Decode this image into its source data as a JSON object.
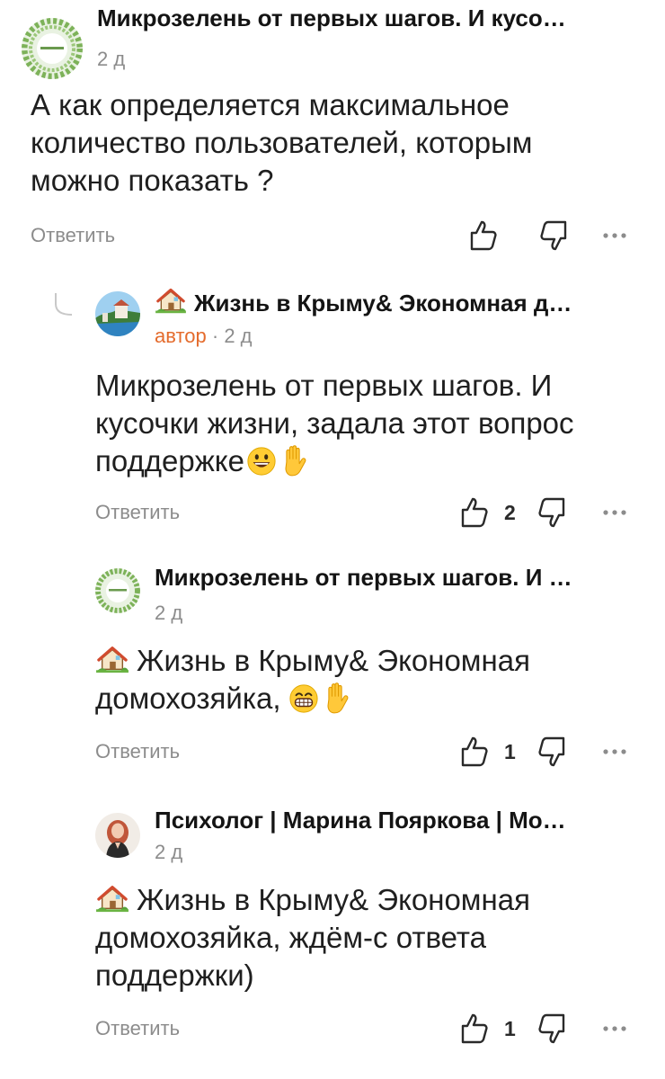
{
  "comments": [
    {
      "author": "Микрозелень от первых шагов. И кусо…",
      "time": "2 д",
      "text": "А как определяется максимальное количество пользователей, которым можно показать ?",
      "reply_label": "Ответить",
      "likes": ""
    },
    {
      "author": "Жизнь в Крыму& Экономная д…",
      "badge": "автор",
      "separator": "·",
      "time": "2 д",
      "text": "Микрозелень от первых шагов. И кусочки жизни, задала этот вопрос поддержке",
      "reply_label": "Ответить",
      "likes": "2"
    },
    {
      "author": "Микрозелень от первых шагов. И …",
      "time": "2 д",
      "text_mention": "Жизнь в Крыму& Экономная домохозяйка,",
      "reply_label": "Ответить",
      "likes": "1"
    },
    {
      "author": "Психолог | Марина Пояркова | Мо…",
      "time": "2 д",
      "text_mention": "Жизнь в Крыму& Экономная домохозяйка, ждём-с ответа поддержки)",
      "reply_label": "Ответить",
      "likes": "1"
    }
  ],
  "icons": {
    "like": "thumbs-up-icon",
    "dislike": "thumbs-down-icon",
    "more": "more-dots-icon",
    "house": "house-icon",
    "smile": "smiling-face-emoji",
    "grin": "grinning-face-emoji",
    "hand": "raised-hand-emoji"
  },
  "colors": {
    "author_badge": "#e46b2c",
    "muted_text": "#8c8c8c"
  }
}
